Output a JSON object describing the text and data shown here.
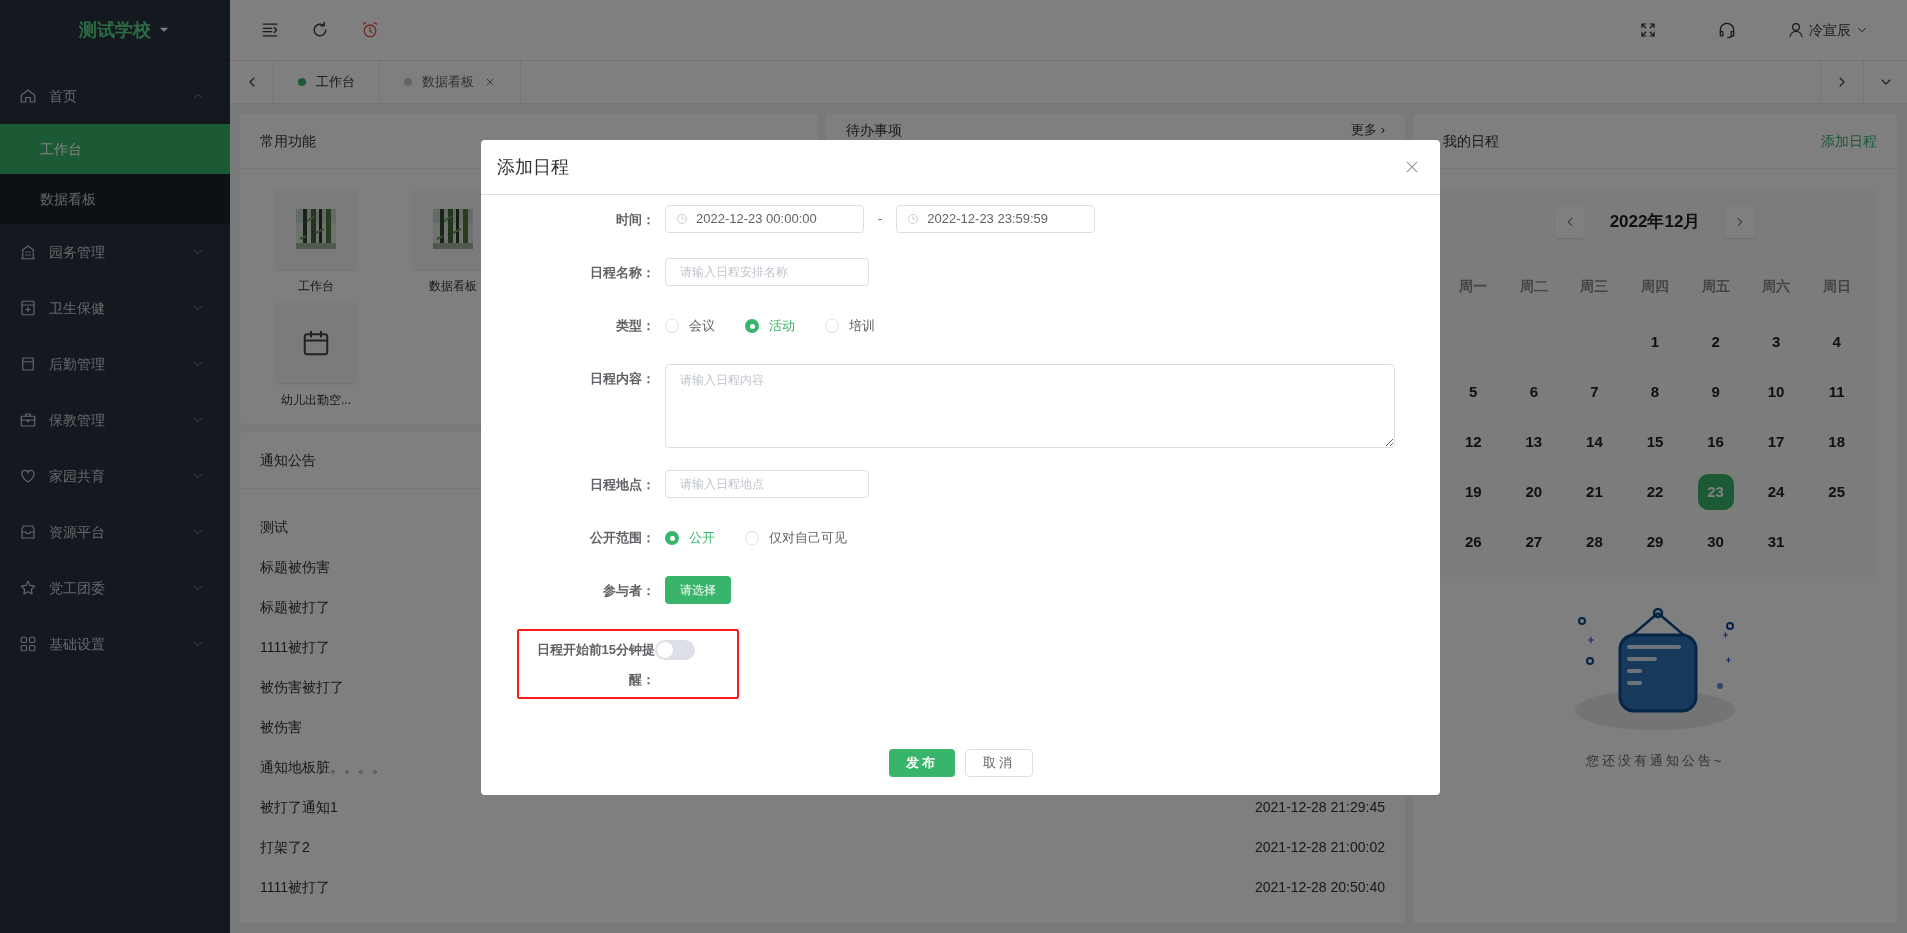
{
  "sidebar": {
    "logo": "测试学校",
    "menu": [
      {
        "label": "首页",
        "expanded": true,
        "children": [
          {
            "label": "工作台",
            "selected": true
          },
          {
            "label": "数据看板",
            "selected": false
          }
        ]
      },
      {
        "label": "园务管理",
        "expanded": false
      },
      {
        "label": "卫生保健",
        "expanded": false
      },
      {
        "label": "后勤管理",
        "expanded": false
      },
      {
        "label": "保教管理",
        "expanded": false
      },
      {
        "label": "家园共育",
        "expanded": false
      },
      {
        "label": "资源平台",
        "expanded": false
      },
      {
        "label": "党工团委",
        "expanded": false
      },
      {
        "label": "基础设置",
        "expanded": false
      }
    ]
  },
  "header": {
    "user": "冷宣辰"
  },
  "tabs": [
    {
      "label": "工作台",
      "selected": true,
      "closable": false
    },
    {
      "label": "数据看板",
      "selected": false,
      "closable": true
    }
  ],
  "shortcuts": {
    "title": "常用功能",
    "items": [
      {
        "label": "工作台",
        "kind": "picture"
      },
      {
        "label": "数据看板",
        "kind": "picture"
      },
      {
        "label": "幼儿出勤空...",
        "kind": "calendar"
      }
    ]
  },
  "todo": {
    "title": "待办事项",
    "more": "更多 ›"
  },
  "notices": {
    "title": "通知公告",
    "rows": [
      {
        "title": "测试"
      },
      {
        "title": "标题被伤害"
      },
      {
        "title": "标题被打了"
      },
      {
        "title": "1111被打了"
      },
      {
        "title": "被伤害被打了"
      },
      {
        "title": "被伤害"
      },
      {
        "title": "通知地板脏。。。。"
      },
      {
        "title": "被打了通知1",
        "time": "2021-12-28 21:29:45"
      },
      {
        "title": "打架了2",
        "time": "2021-12-28 21:00:02"
      },
      {
        "title": "1111被打了",
        "time": "2021-12-28 20:50:40"
      }
    ]
  },
  "schedule": {
    "title": "我的日程",
    "action": "添加日程",
    "month": "2022年12月",
    "weekdays": [
      "周一",
      "周二",
      "周三",
      "周四",
      "周五",
      "周六",
      "周日"
    ],
    "weeks": [
      [
        {
          "kind": "blank"
        },
        {
          "kind": "blank"
        },
        {
          "kind": "blank"
        },
        {
          "kind": "day",
          "label": "1",
          "selected": false
        },
        {
          "kind": "day",
          "label": "2",
          "selected": false
        },
        {
          "kind": "day",
          "label": "3",
          "selected": false
        },
        {
          "kind": "day",
          "label": "4",
          "selected": false
        }
      ],
      [
        {
          "kind": "day",
          "label": "5",
          "selected": false
        },
        {
          "kind": "day",
          "label": "6",
          "selected": false
        },
        {
          "kind": "day",
          "label": "7",
          "selected": false
        },
        {
          "kind": "day",
          "label": "8",
          "selected": false
        },
        {
          "kind": "day",
          "label": "9",
          "selected": false
        },
        {
          "kind": "day",
          "label": "10",
          "selected": false
        },
        {
          "kind": "day",
          "label": "11",
          "selected": false
        }
      ],
      [
        {
          "kind": "day",
          "label": "12",
          "selected": false
        },
        {
          "kind": "day",
          "label": "13",
          "selected": false
        },
        {
          "kind": "day",
          "label": "14",
          "selected": false
        },
        {
          "kind": "day",
          "label": "15",
          "selected": false
        },
        {
          "kind": "day",
          "label": "16",
          "selected": false
        },
        {
          "kind": "day",
          "label": "17",
          "selected": false
        },
        {
          "kind": "day",
          "label": "18",
          "selected": false
        }
      ],
      [
        {
          "kind": "day",
          "label": "19",
          "selected": false
        },
        {
          "kind": "day",
          "label": "20",
          "selected": false
        },
        {
          "kind": "day",
          "label": "21",
          "selected": false
        },
        {
          "kind": "day",
          "label": "22",
          "selected": false
        },
        {
          "kind": "day",
          "label": "23",
          "selected": true
        },
        {
          "kind": "day",
          "label": "24",
          "selected": false
        },
        {
          "kind": "day",
          "label": "25",
          "selected": false
        }
      ],
      [
        {
          "kind": "day",
          "label": "26",
          "selected": false
        },
        {
          "kind": "day",
          "label": "27",
          "selected": false
        },
        {
          "kind": "day",
          "label": "28",
          "selected": false
        },
        {
          "kind": "day",
          "label": "29",
          "selected": false
        },
        {
          "kind": "day",
          "label": "30",
          "selected": false
        },
        {
          "kind": "day",
          "label": "31",
          "selected": false
        },
        {
          "kind": "blank"
        }
      ]
    ],
    "empty_text": "您还没有通知公告~"
  },
  "dialog": {
    "title": "添加日程",
    "fields": [
      {
        "kind": "daterange",
        "label": "时间：",
        "start": "2022-12-23 00:00:00",
        "separator": "-",
        "end": "2022-12-23 23:59:59"
      },
      {
        "kind": "input",
        "label": "日程名称：",
        "placeholder": "请输入日程安排名称"
      },
      {
        "kind": "radio",
        "label": "类型：",
        "options": [
          {
            "label": "会议",
            "selected": false
          },
          {
            "label": "活动",
            "selected": true
          },
          {
            "label": "培训",
            "selected": false
          }
        ]
      },
      {
        "kind": "textarea",
        "label": "日程内容：",
        "placeholder": "请输入日程内容"
      },
      {
        "kind": "input",
        "label": "日程地点：",
        "placeholder": "请输入日程地点"
      },
      {
        "kind": "radio",
        "label": "公开范围：",
        "options": [
          {
            "label": "公开",
            "selected": true
          },
          {
            "label": "仅对自己可见",
            "selected": false
          }
        ]
      },
      {
        "kind": "button",
        "label": "参与者：",
        "button": "请选择"
      },
      {
        "kind": "switch",
        "label": "日程开始前15分钟提醒：",
        "on": false,
        "highlighted": true
      }
    ],
    "buttons": [
      {
        "label": "发布",
        "primary": true
      },
      {
        "label": "取消",
        "primary": false
      }
    ]
  }
}
